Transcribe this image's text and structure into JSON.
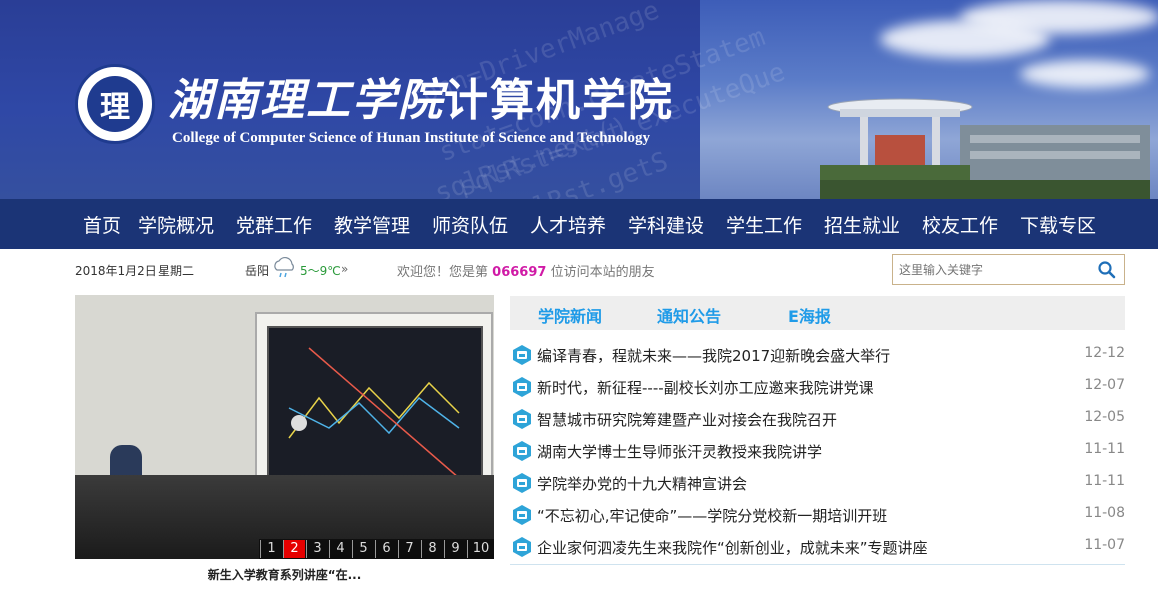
{
  "header": {
    "title_cn_school": "湖南理工学院",
    "title_cn_college": "计算机学院",
    "title_en": "College of Computer Science of Hunan Institute of Science and Technology",
    "seal_text": "理",
    "watermark": [
      "conn=DriverManage",
      "stat=conn.createStatem",
      "sqlRst=stmt.executeQue",
      "sqlRst.next()",
      "sqlRst.getS"
    ]
  },
  "nav": {
    "items": [
      "首页",
      "学院概况",
      "党群工作",
      "教学管理",
      "师资队伍",
      "人才培养",
      "学科建设",
      "学生工作",
      "招生就业",
      "校友工作",
      "下载专区"
    ]
  },
  "info": {
    "date": "2018年1月2日",
    "weekday": "星期二",
    "city": "岳阳",
    "temp": "5～9℃",
    "more": "»",
    "welcome_prefix": "欢迎您！您是第",
    "visitor_count": "066697",
    "welcome_suffix": "位访问本站的朋友"
  },
  "search": {
    "placeholder": "这里输入关键字"
  },
  "slideshow": {
    "pages": [
      "1",
      "2",
      "3",
      "4",
      "5",
      "6",
      "7",
      "8",
      "9",
      "10"
    ],
    "active_page": 1,
    "caption": "新生入学教育系列讲座“在..."
  },
  "news": {
    "tabs": [
      "学院新闻",
      "通知公告",
      "E海报"
    ],
    "items": [
      {
        "title": "编译青春，程就未来——我院2017迎新晚会盛大举行",
        "date": "12-12"
      },
      {
        "title": "新时代，新征程----副校长刘亦工应邀来我院讲党课",
        "date": "12-07"
      },
      {
        "title": "智慧城市研究院筹建暨产业对接会在我院召开",
        "date": "12-05"
      },
      {
        "title": "湖南大学博士生导师张汗灵教授来我院讲学",
        "date": "11-11"
      },
      {
        "title": "学院举办党的十九大精神宣讲会",
        "date": "11-11"
      },
      {
        "title": "“不忘初心,牢记使命”——学院分党校新一期培训开班",
        "date": "11-08"
      },
      {
        "title": "企业家何泗凌先生来我院作“创新创业，成就未来”专题讲座",
        "date": "11-07"
      }
    ]
  },
  "colors": {
    "nav_bg": "#1b3476",
    "tab_text": "#1f9be8",
    "visitor_count": "#d01aa6",
    "active_page": "#e60000"
  }
}
